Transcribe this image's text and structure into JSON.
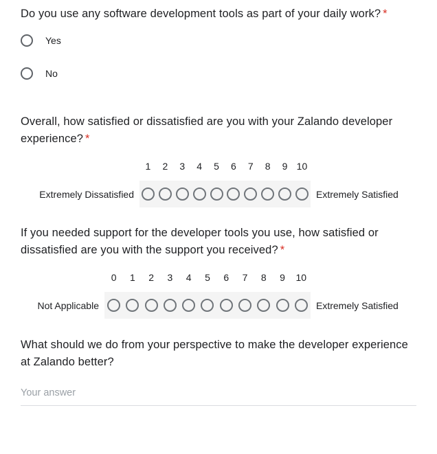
{
  "form": {
    "required_marker": "*",
    "accent_required_color": "#d93025",
    "scale_band_color": "#f4f4f4"
  },
  "questions": [
    {
      "id": "q1",
      "type": "radio",
      "title": "Do you use any software development tools as part of your daily work?",
      "required": true,
      "options": [
        {
          "label": "Yes"
        },
        {
          "label": "No"
        }
      ]
    },
    {
      "id": "q2",
      "type": "linear-scale",
      "title": "Overall, how satisfied or dissatisfied are you with your Zalando developer experience?",
      "required": true,
      "low_label": "Extremely Dissatisfied",
      "high_label": "Extremely Satisfied",
      "scale": [
        "1",
        "2",
        "3",
        "4",
        "5",
        "6",
        "7",
        "8",
        "9",
        "10"
      ]
    },
    {
      "id": "q3",
      "type": "linear-scale",
      "title": "If you needed support for the developer tools you use, how satisfied or dissatisfied are you with the support you received?",
      "required": true,
      "low_label": "Not Applicable",
      "high_label": "Extremely Satisfied",
      "scale": [
        "0",
        "1",
        "2",
        "3",
        "4",
        "5",
        "6",
        "7",
        "8",
        "9",
        "10"
      ]
    },
    {
      "id": "q4",
      "type": "short-answer",
      "title": "What should we do from your perspective to make the developer experience at Zalando better?",
      "required": false,
      "answer_value": "",
      "answer_placeholder": "Your answer"
    }
  ]
}
